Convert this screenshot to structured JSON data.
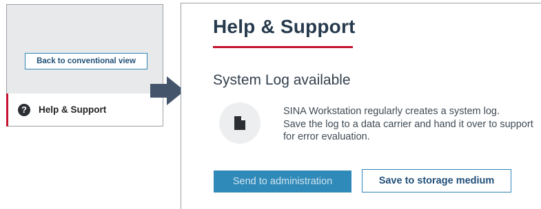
{
  "left_panel": {
    "back_button": "Back to conventional view",
    "help_item": {
      "icon": "question-circle-icon",
      "label": "Help & Support"
    }
  },
  "main": {
    "title": "Help & Support",
    "section_title": "System Log available",
    "doc_icon": "document-icon",
    "description_lines": [
      "SINA Workstation regularly creates a system log.",
      "Save the log to a data carrier and hand it over to support",
      "for error evaluation."
    ],
    "buttons": {
      "send": "Send to administration",
      "save": "Save to storage medium"
    }
  },
  "colors": {
    "accent_red": "#c41230",
    "primary_blue": "#2f8ab9",
    "arrow": "#44546a"
  }
}
